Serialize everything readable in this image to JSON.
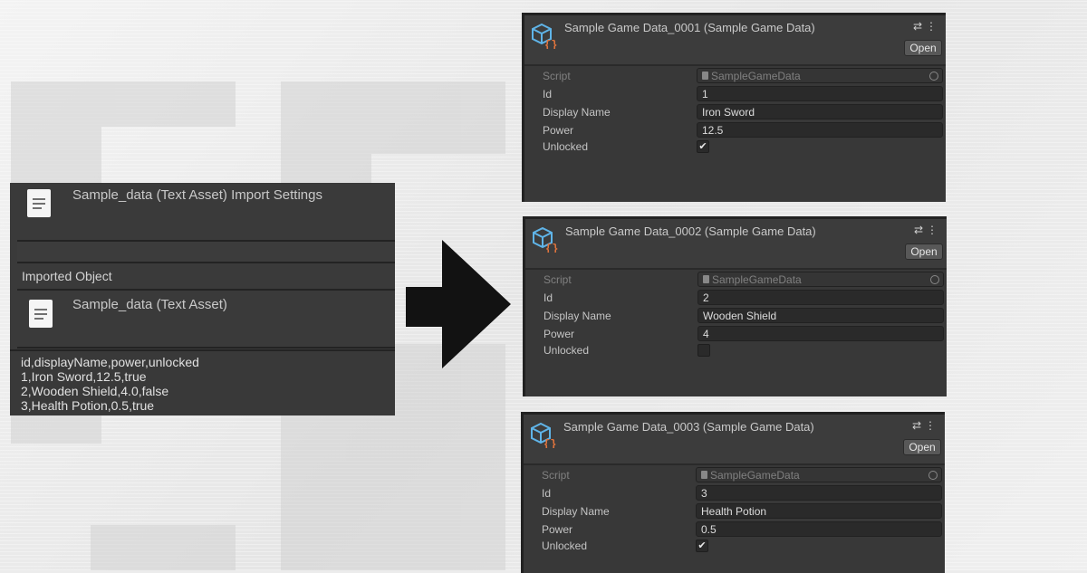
{
  "import_panel": {
    "title": "Sample_data (Text Asset) Import Settings",
    "imported_object_label": "Imported Object",
    "imported_asset_name": "Sample_data (Text Asset)",
    "csv_lines": [
      "id,displayName,power,unlocked",
      "1,Iron Sword,12.5,true",
      "2,Wooden Shield,4.0,false",
      "3,Health Potion,0.5,true"
    ]
  },
  "inspectors": [
    {
      "title": "Sample Game Data_0001 (Sample Game Data)",
      "open_label": "Open",
      "labels": {
        "script": "Script",
        "id": "Id",
        "display_name": "Display Name",
        "power": "Power",
        "unlocked": "Unlocked"
      },
      "values": {
        "script": "SampleGameData",
        "id": "1",
        "display_name": "Iron Sword",
        "power": "12.5",
        "unlocked": true
      }
    },
    {
      "title": "Sample Game Data_0002 (Sample Game Data)",
      "open_label": "Open",
      "labels": {
        "script": "Script",
        "id": "Id",
        "display_name": "Display Name",
        "power": "Power",
        "unlocked": "Unlocked"
      },
      "values": {
        "script": "SampleGameData",
        "id": "2",
        "display_name": "Wooden Shield",
        "power": "4",
        "unlocked": false
      }
    },
    {
      "title": "Sample Game Data_0003 (Sample Game Data)",
      "open_label": "Open",
      "labels": {
        "script": "Script",
        "id": "Id",
        "display_name": "Display Name",
        "power": "Power",
        "unlocked": "Unlocked"
      },
      "values": {
        "script": "SampleGameData",
        "id": "3",
        "display_name": "Health Potion",
        "power": "0.5",
        "unlocked": true
      }
    }
  ],
  "icons": {
    "text_asset": "document-icon",
    "scriptable_object": "scriptable-object-icon",
    "arrow": "right-arrow-icon"
  },
  "colors": {
    "panel_bg": "#383838",
    "field_bg": "#2a2a2a",
    "icon_blue": "#5fb4e8",
    "icon_orange": "#e0743d"
  }
}
